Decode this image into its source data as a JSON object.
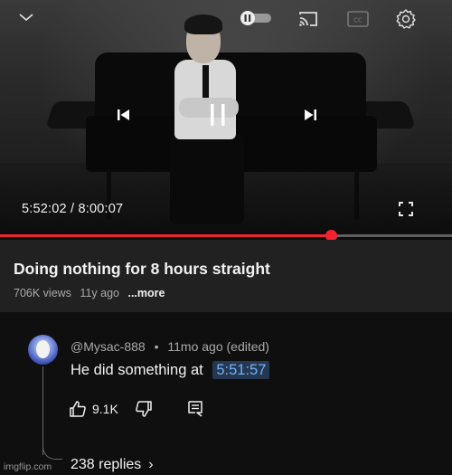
{
  "player": {
    "current_time": "5:52:02",
    "time_separator": "/",
    "duration": "8:00:07",
    "progress_fraction": 0.7325
  },
  "video": {
    "title": "Doing nothing for 8 hours straight",
    "views": "706K views",
    "age": "11y ago",
    "more_label": "...more"
  },
  "comment": {
    "author": "@Mysac-888",
    "separator": "•",
    "time_ago": "11mo ago (edited)",
    "text": "He did something at",
    "timestamp_link": "5:51:57",
    "like_count": "9.1K",
    "replies_label": "238 replies",
    "replies_arrow": "›"
  },
  "watermark": "imgflip.com",
  "colors": {
    "accent_red": "#f0232f",
    "link_blue": "#6fb0ff",
    "background": "#0f0f0f",
    "info_panel": "#212121"
  },
  "icons": [
    "chevron-down-icon",
    "autoplay-toggle-icon",
    "cast-icon",
    "captions-icon",
    "settings-gear-icon",
    "previous-icon",
    "pause-icon",
    "next-icon",
    "fullscreen-icon",
    "like-icon",
    "dislike-icon",
    "reply-comment-icon"
  ]
}
